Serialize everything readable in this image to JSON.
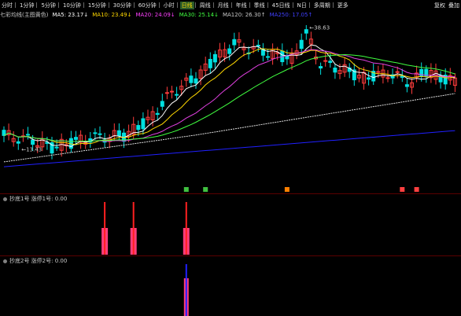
{
  "toolbar": {
    "items": [
      "分时",
      "1分钟",
      "5分钟",
      "10分钟",
      "15分钟",
      "30分钟",
      "60分钟",
      "小时",
      "日线",
      "周线",
      "月线",
      "年线",
      "季线",
      "45日线",
      "N日",
      "多周期",
      "更多"
    ],
    "selected_index": 8,
    "right": [
      "复权",
      "叠加"
    ]
  },
  "ma_bar": {
    "name": "七彩均线(主图黄色)",
    "items": [
      {
        "label": "MA5: 23.17↓",
        "color": "#ffffff"
      },
      {
        "label": "MA10: 23.49↓",
        "color": "#ffd800"
      },
      {
        "label": "MA20: 24.09↓",
        "color": "#ff40ff"
      },
      {
        "label": "MA30: 25.14↓",
        "color": "#40ff40"
      },
      {
        "label": "MA120: 26.30↑",
        "color": "#c8c8c8"
      },
      {
        "label": "MA250: 17.05↑",
        "color": "#4040ff"
      }
    ]
  },
  "price_labels": {
    "high": "38.63",
    "low": "13.43"
  },
  "pane2": {
    "title": "抄底1号 涨停1号: 0.00"
  },
  "pane3": {
    "title": "抄底2号 涨停2号: 0.00"
  },
  "colors": {
    "up": "#ff3c3c",
    "down": "#00e0e0",
    "ma5": "#ffffff",
    "ma10": "#ffd800",
    "ma20": "#e040e0",
    "ma30": "#40ff40",
    "ma120": "#e0e0e0",
    "ma250": "#2020ff"
  }
}
